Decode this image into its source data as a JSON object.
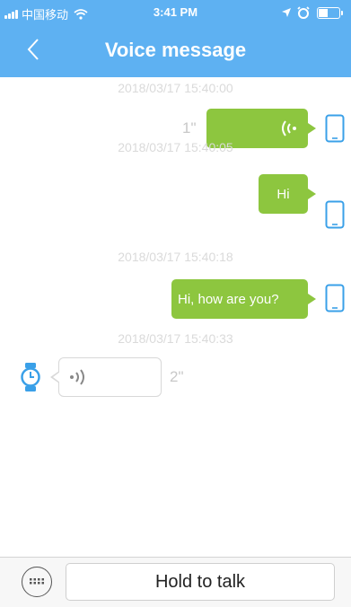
{
  "status_bar": {
    "carrier": "中国移动",
    "time": "3:41 PM"
  },
  "header": {
    "title": "Voice message"
  },
  "messages": [
    {
      "timestamp": "2018/03/17 15:40:00",
      "kind": "voice",
      "direction": "outgoing",
      "duration": "1\""
    },
    {
      "timestamp": "2018/03/17 15:40:05",
      "kind": "text",
      "direction": "outgoing",
      "text": "Hi"
    },
    {
      "timestamp": "2018/03/17 15:40:18",
      "kind": "text",
      "direction": "outgoing",
      "text": "Hi, how are you?"
    },
    {
      "timestamp": "2018/03/17 15:40:33",
      "kind": "voice",
      "direction": "incoming",
      "duration": "2\""
    }
  ],
  "input_bar": {
    "talk_label": "Hold to talk"
  },
  "colors": {
    "header": "#5eb1f2",
    "outgoing_bubble": "#8dc63f",
    "device_icon": "#3aa0e8"
  },
  "icons": [
    "signal-icon",
    "wifi-icon",
    "location-arrow-icon",
    "alarm-icon",
    "battery-icon",
    "back-arrow-icon",
    "phone-device-icon",
    "voice-wave-icon",
    "watch-icon",
    "keyboard-icon"
  ]
}
